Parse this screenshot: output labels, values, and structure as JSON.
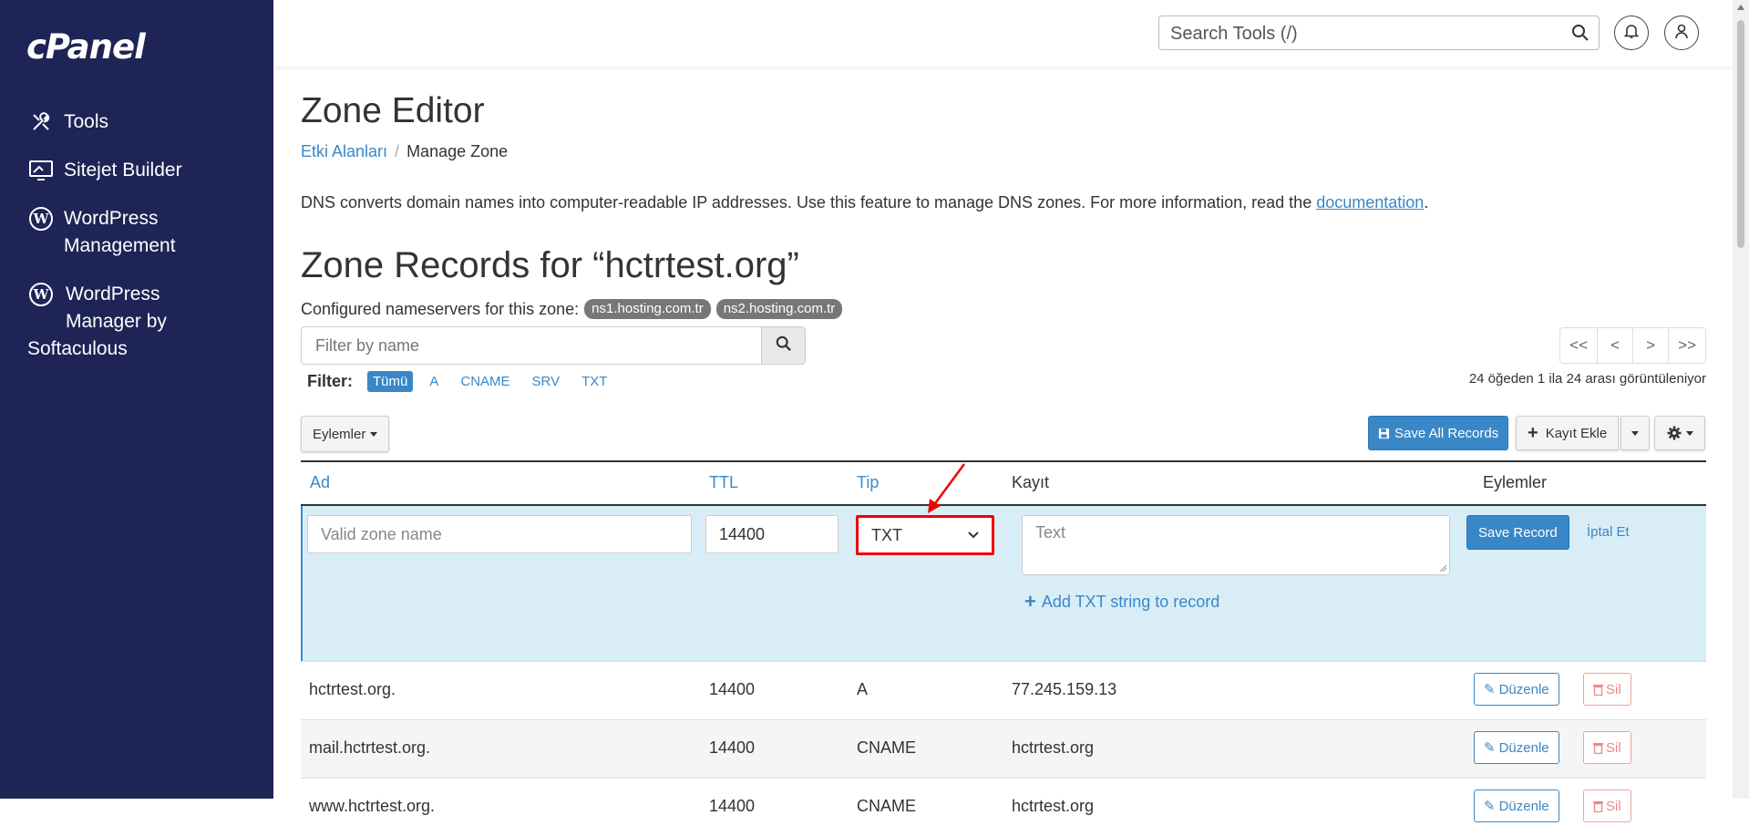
{
  "sidebar": {
    "logo": "cPanel",
    "items": [
      {
        "label": "Tools",
        "icon": "tools-icon"
      },
      {
        "label": "Sitejet Builder",
        "icon": "sitejet-icon"
      },
      {
        "label": "WordPress Management",
        "line1": "WordPress",
        "line2": "Management",
        "icon": "wordpress-icon"
      },
      {
        "label": "WordPress Manager by Softaculous",
        "line1": "WordPress",
        "line2": "Manager by",
        "line3": "Softaculous",
        "icon": "wordpress-icon"
      }
    ]
  },
  "header": {
    "search_placeholder": "Search Tools (/)"
  },
  "page": {
    "title": "Zone Editor",
    "breadcrumb": {
      "parent": "Etki Alanları",
      "current": "Manage Zone"
    },
    "intro_text": "DNS converts domain names into computer-readable IP addresses. Use this feature to manage DNS zones. For more information, read the ",
    "intro_link": "documentation",
    "intro_end": ".",
    "zone_title": "Zone Records for “hctrtest.org”",
    "ns_label": "Configured nameservers for this zone:",
    "nameservers": [
      "ns1.hosting.com.tr",
      "ns2.hosting.com.tr"
    ],
    "filter_placeholder": "Filter by name",
    "pager": [
      "<<",
      "<",
      ">",
      ">>"
    ],
    "count_text": "24 öğeden 1 ila 24 arası görüntüleniyor",
    "filter_label": "Filter:",
    "filters": [
      "Tümü",
      "A",
      "CNAME",
      "SRV",
      "TXT"
    ],
    "actions_label": "Eylemler",
    "save_all_label": "Save All Records",
    "add_record_label": "Kayıt Ekle"
  },
  "table": {
    "headers": {
      "name": "Ad",
      "ttl": "TTL",
      "type": "Tip",
      "record": "Kayıt",
      "actions": "Eylemler"
    },
    "edit_row": {
      "name_placeholder": "Valid zone name",
      "ttl_value": "14400",
      "type_value": "TXT",
      "text_placeholder": "Text",
      "add_txt_label": "Add TXT string to record",
      "save_label": "Save Record",
      "cancel_label": "İptal Et"
    },
    "rows": [
      {
        "name": "hctrtest.org.",
        "ttl": "14400",
        "type": "A",
        "record": "77.245.159.13"
      },
      {
        "name": "mail.hctrtest.org.",
        "ttl": "14400",
        "type": "CNAME",
        "record": "hctrtest.org"
      },
      {
        "name": "www.hctrtest.org.",
        "ttl": "14400",
        "type": "CNAME",
        "record": "hctrtest.org"
      }
    ],
    "edit_label": "Düzenle",
    "delete_label": "Sil"
  },
  "colors": {
    "sidebar_bg": "#1e2456",
    "accent": "#3a87c7",
    "highlight_box": "#ee0000"
  }
}
